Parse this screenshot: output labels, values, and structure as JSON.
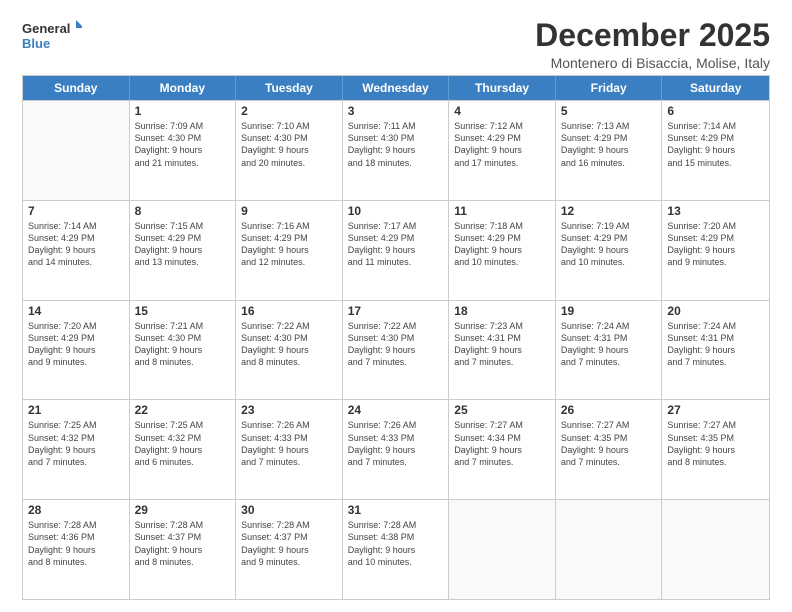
{
  "logo": {
    "line1": "General",
    "line2": "Blue"
  },
  "title": "December 2025",
  "subtitle": "Montenero di Bisaccia, Molise, Italy",
  "days_of_week": [
    "Sunday",
    "Monday",
    "Tuesday",
    "Wednesday",
    "Thursday",
    "Friday",
    "Saturday"
  ],
  "weeks": [
    [
      {
        "day": "",
        "info": ""
      },
      {
        "day": "1",
        "info": "Sunrise: 7:09 AM\nSunset: 4:30 PM\nDaylight: 9 hours\nand 21 minutes."
      },
      {
        "day": "2",
        "info": "Sunrise: 7:10 AM\nSunset: 4:30 PM\nDaylight: 9 hours\nand 20 minutes."
      },
      {
        "day": "3",
        "info": "Sunrise: 7:11 AM\nSunset: 4:30 PM\nDaylight: 9 hours\nand 18 minutes."
      },
      {
        "day": "4",
        "info": "Sunrise: 7:12 AM\nSunset: 4:29 PM\nDaylight: 9 hours\nand 17 minutes."
      },
      {
        "day": "5",
        "info": "Sunrise: 7:13 AM\nSunset: 4:29 PM\nDaylight: 9 hours\nand 16 minutes."
      },
      {
        "day": "6",
        "info": "Sunrise: 7:14 AM\nSunset: 4:29 PM\nDaylight: 9 hours\nand 15 minutes."
      }
    ],
    [
      {
        "day": "7",
        "info": "Sunrise: 7:14 AM\nSunset: 4:29 PM\nDaylight: 9 hours\nand 14 minutes."
      },
      {
        "day": "8",
        "info": "Sunrise: 7:15 AM\nSunset: 4:29 PM\nDaylight: 9 hours\nand 13 minutes."
      },
      {
        "day": "9",
        "info": "Sunrise: 7:16 AM\nSunset: 4:29 PM\nDaylight: 9 hours\nand 12 minutes."
      },
      {
        "day": "10",
        "info": "Sunrise: 7:17 AM\nSunset: 4:29 PM\nDaylight: 9 hours\nand 11 minutes."
      },
      {
        "day": "11",
        "info": "Sunrise: 7:18 AM\nSunset: 4:29 PM\nDaylight: 9 hours\nand 10 minutes."
      },
      {
        "day": "12",
        "info": "Sunrise: 7:19 AM\nSunset: 4:29 PM\nDaylight: 9 hours\nand 10 minutes."
      },
      {
        "day": "13",
        "info": "Sunrise: 7:20 AM\nSunset: 4:29 PM\nDaylight: 9 hours\nand 9 minutes."
      }
    ],
    [
      {
        "day": "14",
        "info": "Sunrise: 7:20 AM\nSunset: 4:29 PM\nDaylight: 9 hours\nand 9 minutes."
      },
      {
        "day": "15",
        "info": "Sunrise: 7:21 AM\nSunset: 4:30 PM\nDaylight: 9 hours\nand 8 minutes."
      },
      {
        "day": "16",
        "info": "Sunrise: 7:22 AM\nSunset: 4:30 PM\nDaylight: 9 hours\nand 8 minutes."
      },
      {
        "day": "17",
        "info": "Sunrise: 7:22 AM\nSunset: 4:30 PM\nDaylight: 9 hours\nand 7 minutes."
      },
      {
        "day": "18",
        "info": "Sunrise: 7:23 AM\nSunset: 4:31 PM\nDaylight: 9 hours\nand 7 minutes."
      },
      {
        "day": "19",
        "info": "Sunrise: 7:24 AM\nSunset: 4:31 PM\nDaylight: 9 hours\nand 7 minutes."
      },
      {
        "day": "20",
        "info": "Sunrise: 7:24 AM\nSunset: 4:31 PM\nDaylight: 9 hours\nand 7 minutes."
      }
    ],
    [
      {
        "day": "21",
        "info": "Sunrise: 7:25 AM\nSunset: 4:32 PM\nDaylight: 9 hours\nand 7 minutes."
      },
      {
        "day": "22",
        "info": "Sunrise: 7:25 AM\nSunset: 4:32 PM\nDaylight: 9 hours\nand 6 minutes."
      },
      {
        "day": "23",
        "info": "Sunrise: 7:26 AM\nSunset: 4:33 PM\nDaylight: 9 hours\nand 7 minutes."
      },
      {
        "day": "24",
        "info": "Sunrise: 7:26 AM\nSunset: 4:33 PM\nDaylight: 9 hours\nand 7 minutes."
      },
      {
        "day": "25",
        "info": "Sunrise: 7:27 AM\nSunset: 4:34 PM\nDaylight: 9 hours\nand 7 minutes."
      },
      {
        "day": "26",
        "info": "Sunrise: 7:27 AM\nSunset: 4:35 PM\nDaylight: 9 hours\nand 7 minutes."
      },
      {
        "day": "27",
        "info": "Sunrise: 7:27 AM\nSunset: 4:35 PM\nDaylight: 9 hours\nand 8 minutes."
      }
    ],
    [
      {
        "day": "28",
        "info": "Sunrise: 7:28 AM\nSunset: 4:36 PM\nDaylight: 9 hours\nand 8 minutes."
      },
      {
        "day": "29",
        "info": "Sunrise: 7:28 AM\nSunset: 4:37 PM\nDaylight: 9 hours\nand 8 minutes."
      },
      {
        "day": "30",
        "info": "Sunrise: 7:28 AM\nSunset: 4:37 PM\nDaylight: 9 hours\nand 9 minutes."
      },
      {
        "day": "31",
        "info": "Sunrise: 7:28 AM\nSunset: 4:38 PM\nDaylight: 9 hours\nand 10 minutes."
      },
      {
        "day": "",
        "info": ""
      },
      {
        "day": "",
        "info": ""
      },
      {
        "day": "",
        "info": ""
      }
    ]
  ]
}
